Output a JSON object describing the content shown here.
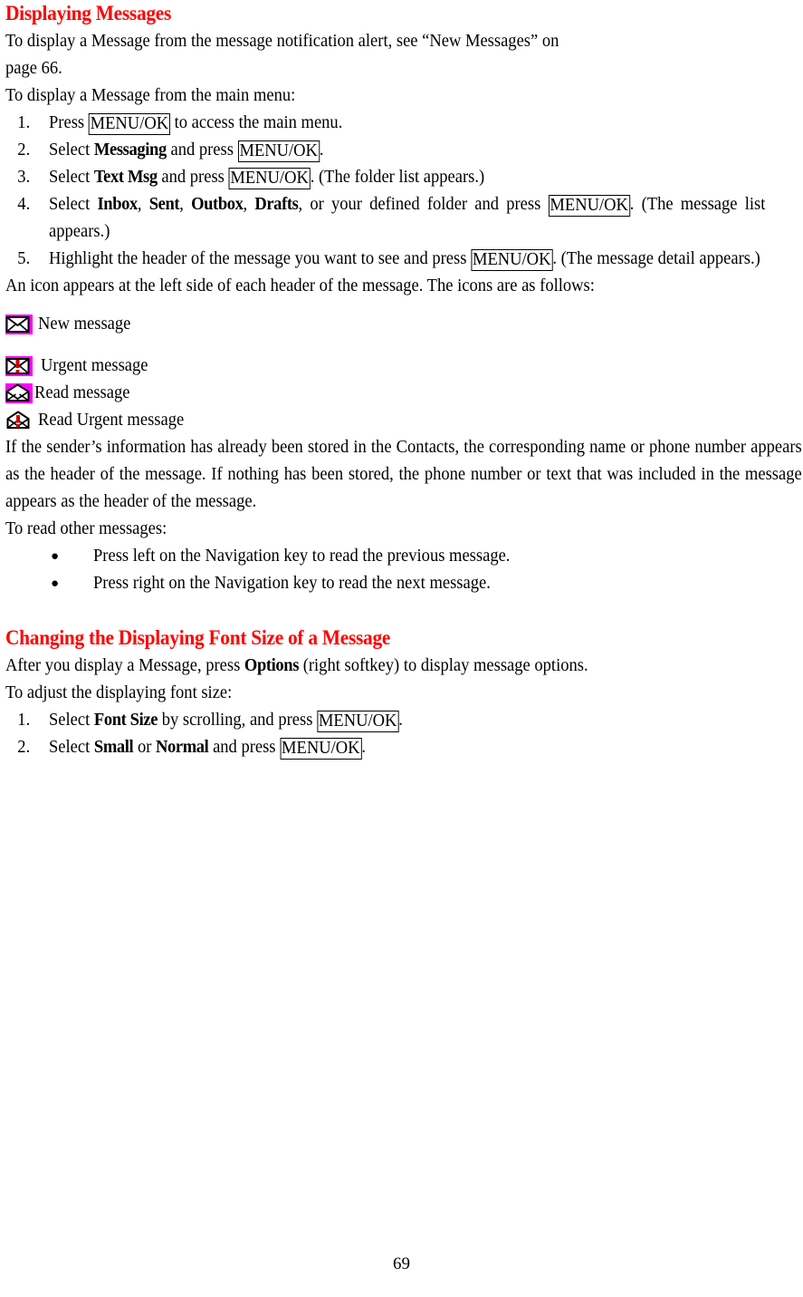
{
  "document": {
    "page_number": "69"
  },
  "sections": [
    {
      "heading": "Displaying Messages",
      "intro_line_1": "To display a Message from the message notification alert, see “New Messages” on",
      "intro_line_2": "page 66.",
      "intro_line_3": "To display a Message from the main menu:"
    },
    {
      "heading": "Changing the Displaying Font Size of a Message"
    }
  ],
  "steps_display": [
    {
      "num": "1.",
      "pre": "Press ",
      "key": "MENU/OK",
      "post": " to access the main menu."
    },
    {
      "num": "2.",
      "pre": "Select ",
      "bold": "Messaging",
      "mid": " and press ",
      "key": "MENU/OK",
      "post": "."
    },
    {
      "num": "3.",
      "pre": "Select ",
      "bold": "Text Msg",
      "mid": " and press ",
      "key": "MENU/OK",
      "post": ". (The folder list appears.)"
    },
    {
      "num": "4.",
      "pre": "Select ",
      "bold1": "Inbox",
      "sep1": ", ",
      "bold2": "Sent",
      "sep2": ", ",
      "bold3": "Outbox",
      "sep3": ", ",
      "bold4": "Drafts",
      "mid": ", or your defined folder and press ",
      "key": "MENU/OK",
      "post": ". (The message list appears.)"
    },
    {
      "num": "5.",
      "pre": "Highlight the header of the message you want to see and press ",
      "key": "MENU/OK",
      "post": ". (The message detail appears.)"
    }
  ],
  "icons_intro": "An icon appears at the left side of each header of the message. The icons are as follows:",
  "icons": [
    {
      "name": "new-message-icon",
      "label": "New message",
      "state": "unread",
      "urgent": false,
      "background": "#FF00FF"
    },
    {
      "name": "urgent-message-icon",
      "label": "Urgent message",
      "state": "unread",
      "urgent": true,
      "background": "#FF00FF"
    },
    {
      "name": "read-message-icon",
      "label": "Read message",
      "state": "read",
      "urgent": false,
      "background": "#FF00FF"
    },
    {
      "name": "read-urgent-message-icon",
      "label": "Read Urgent message",
      "state": "read",
      "urgent": true,
      "background": "none"
    }
  ],
  "sender_paragraph": "If the sender’s information has already been stored in the Contacts, the corresponding name or phone number appears as the header of the message. If nothing has been stored, the phone number or text that was included in the message appears as the header of the message.",
  "read_other": {
    "intro": "To read other messages:",
    "bullets": [
      {
        "bullet": "●",
        "text": "Press left on the Navigation key to read the previous message."
      },
      {
        "bullet": "●",
        "text": "Press right on the Navigation key to read the next message."
      }
    ]
  },
  "font_size_section": {
    "intro_pre": "After you display a Message, press ",
    "intro_bold": "Options",
    "intro_post": " (right softkey) to display message options.",
    "intro_line_2": "To adjust the displaying font size:",
    "steps": [
      {
        "num": "1.",
        "pre": "Select ",
        "bold": "Font Size",
        "mid": " by scrolling, and press ",
        "key": "MENU/OK",
        "post": "."
      },
      {
        "num": "2.",
        "pre": "Select ",
        "bold1": "Small",
        "mid1": " or ",
        "bold2": "Normal",
        "mid": " and press ",
        "key": "MENU/OK",
        "post": "."
      }
    ]
  },
  "colors": {
    "heading": "#FF0000",
    "icon_highlight": "#FF00FF",
    "urgent_mark": "#CC0000",
    "text": "#000000"
  }
}
